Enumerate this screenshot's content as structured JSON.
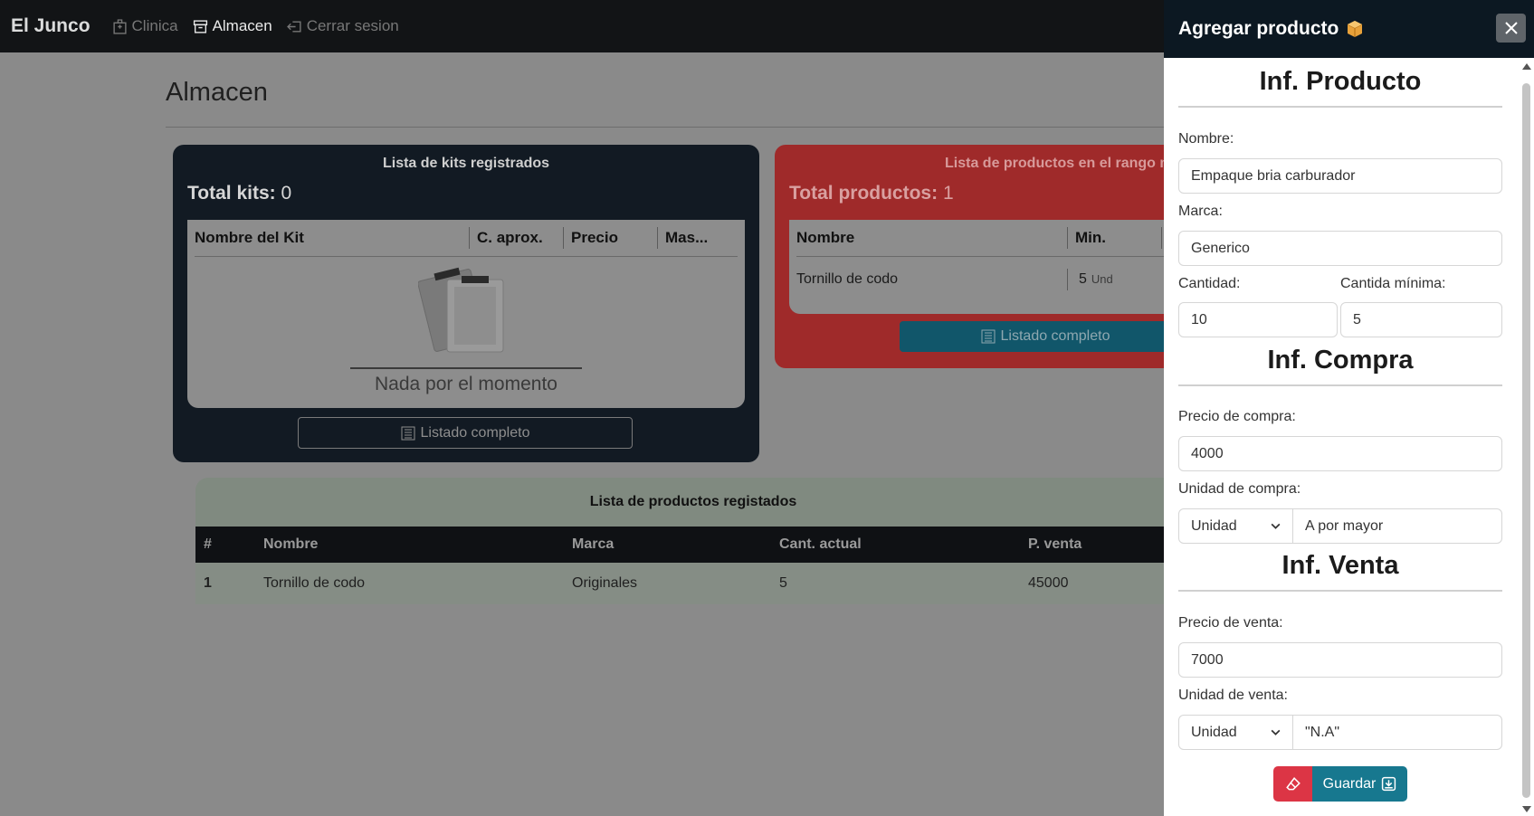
{
  "navbar": {
    "brand": "El Junco",
    "links": [
      {
        "label": "Clinica",
        "icon": "hospital-icon"
      },
      {
        "label": "Almacen",
        "icon": "archive-icon"
      },
      {
        "label": "Cerrar sesion",
        "icon": "logout-icon"
      }
    ]
  },
  "page": {
    "title": "Almacen"
  },
  "kits_card": {
    "title": "Lista de kits registrados",
    "total_label": "Total kits:",
    "total_value": "0",
    "columns": [
      "Nombre del Kit",
      "C. aprox.",
      "Precio",
      "Mas..."
    ],
    "empty_text": "Nada por el momento",
    "button_label": "Listado completo"
  },
  "range_card": {
    "title": "Lista de productos en el rango m",
    "total_label": "Total productos:",
    "total_value": "1",
    "columns": [
      "Nombre",
      "Min."
    ],
    "rows": [
      {
        "nombre": "Tornillo de codo",
        "min": "5",
        "unit": "Und"
      }
    ],
    "button_label": "Listado completo"
  },
  "products_table": {
    "caption": "Lista de productos registados",
    "columns": [
      "#",
      "Nombre",
      "Marca",
      "Cant. actual",
      "P. venta"
    ],
    "rows": [
      {
        "num": "1",
        "nombre": "Tornillo de codo",
        "marca": "Originales",
        "cant": "5",
        "venta": "45000"
      }
    ]
  },
  "offcanvas": {
    "title": "Agregar producto",
    "title_icon": "package-icon",
    "producto": {
      "heading": "Inf. Producto",
      "nombre_label": "Nombre:",
      "nombre_value": "Empaque bria carburador",
      "marca_label": "Marca:",
      "marca_value": "Generico",
      "cantidad_label": "Cantidad:",
      "cantidad_value": "10",
      "minima_label": "Cantida mínima:",
      "minima_value": "5"
    },
    "compra": {
      "heading": "Inf. Compra",
      "precio_label": "Precio de compra:",
      "precio_value": "4000",
      "unidad_label": "Unidad de compra:",
      "unidad_select": "Unidad",
      "unidad_value": "A por mayor"
    },
    "venta": {
      "heading": "Inf. Venta",
      "precio_label": "Precio de venta:",
      "precio_value": "7000",
      "unidad_label": "Unidad de venta:",
      "unidad_select": "Unidad",
      "unidad_value": "\"N.A\""
    },
    "save_label": "Guardar"
  },
  "colors": {
    "danger": "#dc3545",
    "info": "#17788f",
    "navbar": "#121416"
  }
}
